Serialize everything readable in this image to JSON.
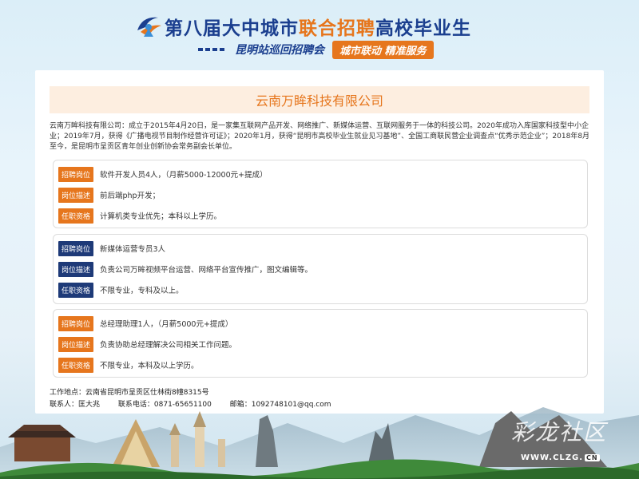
{
  "header": {
    "title_part1": "第八届大中城市",
    "title_highlight": "联合招聘",
    "title_part2": "高校毕业生",
    "subtitle_left": "昆明站巡回招聘会",
    "subtitle_right": "城市联动 精准服务"
  },
  "company": {
    "name": "云南万眸科技有限公司",
    "intro": "云南万眸科技有限公司：成立于2015年4月20日，是一家集互联网产品开发、网络推广、新媒体运营、互联网服务于一体的科技公司。2020年成功入库国家科技型中小企业；2019年7月，获得《广播电视节目制作经营许可证》；2020年1月，获得“昆明市高校毕业生就业见习基地”、全国工商联民营企业调查点“优秀示范企业”；2018年8月至今，是昆明市呈贡区青年创业创新协会常务副会长单位。"
  },
  "jobs": [
    {
      "tag_color": "#e6761d",
      "position_label": "招聘岗位",
      "position": "软件开发人员4人，（月薪5000-12000元+提成）",
      "desc_label": "岗位描述",
      "desc": "前后端php开发；",
      "req_label": "任职资格",
      "req": "计算机类专业优先；本科以上学历。"
    },
    {
      "tag_color": "#1e3a78",
      "position_label": "招聘岗位",
      "position": "新媒体运营专员3人",
      "desc_label": "岗位描述",
      "desc": "负责公司万眸视频平台运营、网络平台宣传推广，图文编辑等。",
      "req_label": "任职资格",
      "req": "不限专业，专科及以上。"
    },
    {
      "tag_color": "#e6761d",
      "position_label": "招聘岗位",
      "position": "总经理助理1人，（月薪5000元+提成）",
      "desc_label": "岗位描述",
      "desc": "负责协助总经理解决公司相关工作问题。",
      "req_label": "任职资格",
      "req": "不限专业，本科及以上学历。"
    }
  ],
  "contact": {
    "address": "工作地点：云南省昆明市呈贡区仕林街8幢8315号",
    "person": "联系人：匡大兆",
    "phone": "联系电话：0871-65651100",
    "email": "邮箱：1092748101@qq.com"
  },
  "watermark": {
    "text": "彩龙社区",
    "url": "WWW.CLZG.",
    "badge": "CN"
  }
}
